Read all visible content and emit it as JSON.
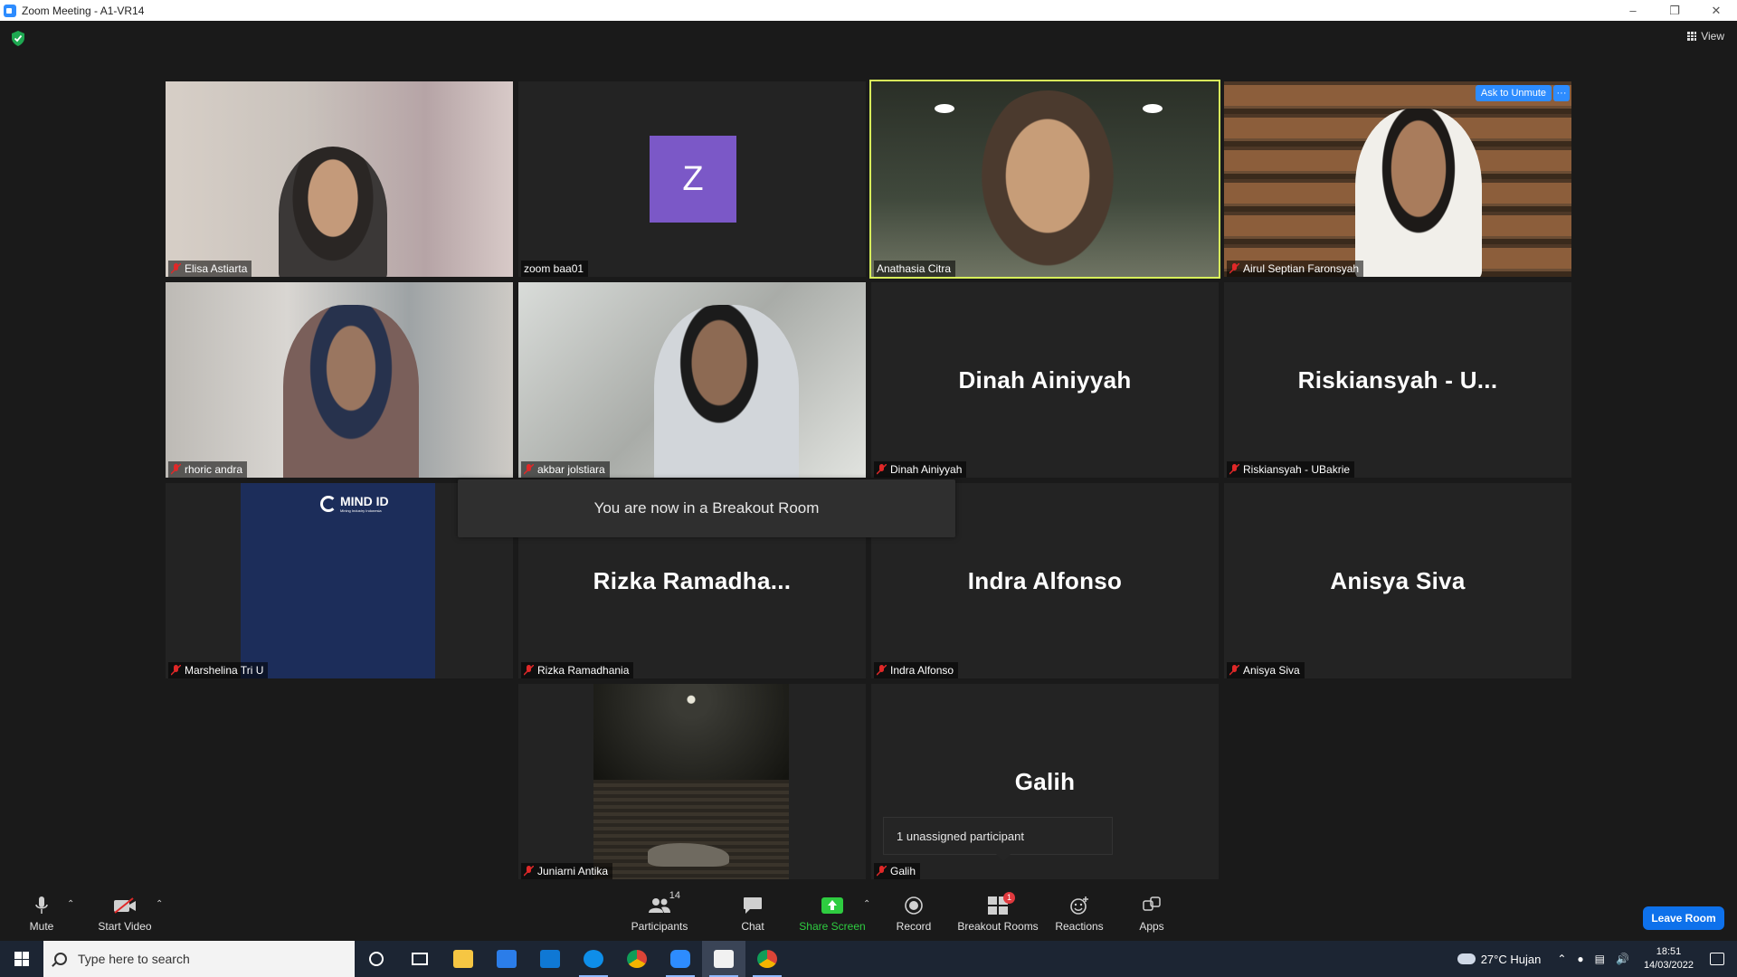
{
  "window": {
    "title": "Zoom Meeting - A1-VR14",
    "controls": [
      "minimize",
      "restore",
      "close"
    ]
  },
  "meeting": {
    "view_label": "View",
    "ask_to_unmute": "Ask to Unmute",
    "more_label": "···",
    "breakout_message": "You are now in a Breakout Room",
    "unassigned_message": "1 unassigned participant",
    "tiles": [
      {
        "name": "Elisa Astiarta",
        "muted": true,
        "type": "video"
      },
      {
        "name": "zoom baa01",
        "muted": false,
        "type": "avatar",
        "avatar_letter": "Z"
      },
      {
        "name": "Anathasia Citra",
        "muted": false,
        "type": "video",
        "speaking": true
      },
      {
        "name": "Airul Septian Faronsyah",
        "muted": true,
        "type": "video"
      },
      {
        "name": "rhoric andra",
        "muted": true,
        "type": "video"
      },
      {
        "name": "akbar jolstiara",
        "muted": true,
        "type": "video"
      },
      {
        "name": "Dinah Ainiyyah",
        "muted": true,
        "type": "name",
        "big_name": "Dinah Ainiyyah"
      },
      {
        "name": "Riskiansyah - UBakrie",
        "muted": true,
        "type": "name",
        "big_name": "Riskiansyah - U..."
      },
      {
        "name": "Marshelina Tri U",
        "muted": true,
        "type": "image",
        "image_text": "MIND ID",
        "image_subtext": "Mining Industry Indonesia"
      },
      {
        "name": "Rizka Ramadhania",
        "muted": true,
        "type": "name",
        "big_name": "Rizka Ramadha..."
      },
      {
        "name": "Indra Alfonso",
        "muted": true,
        "type": "name",
        "big_name": "Indra Alfonso"
      },
      {
        "name": "Anisya Siva",
        "muted": true,
        "type": "name",
        "big_name": "Anisya Siva"
      },
      {
        "name": "Juniarni Antika",
        "muted": true,
        "type": "video"
      },
      {
        "name": "Galih",
        "muted": true,
        "type": "name",
        "big_name": "Galih"
      }
    ]
  },
  "toolbar": {
    "mute": "Mute",
    "start_video": "Start Video",
    "participants": "Participants",
    "participants_count": "14",
    "chat": "Chat",
    "share_screen": "Share Screen",
    "record": "Record",
    "breakout_rooms": "Breakout Rooms",
    "breakout_badge": "1",
    "reactions": "Reactions",
    "apps": "Apps",
    "leave_room": "Leave Room",
    "colors": {
      "share": "#2ecc40",
      "leave": "#0e71eb",
      "speaking_border": "#d8f05a",
      "avatar": "#7b58c7"
    }
  },
  "taskbar": {
    "search_placeholder": "Type here to search",
    "weather": "27°C  Hujan",
    "time": "18:51",
    "date": "14/03/2022",
    "apps": [
      "cortana-icon",
      "task-view-icon",
      "file-explorer-icon",
      "store-icon",
      "mail-icon",
      "teamviewer-icon",
      "chrome-icon",
      "zoom-icon",
      "notes-icon",
      "chrome-alt-icon"
    ]
  }
}
